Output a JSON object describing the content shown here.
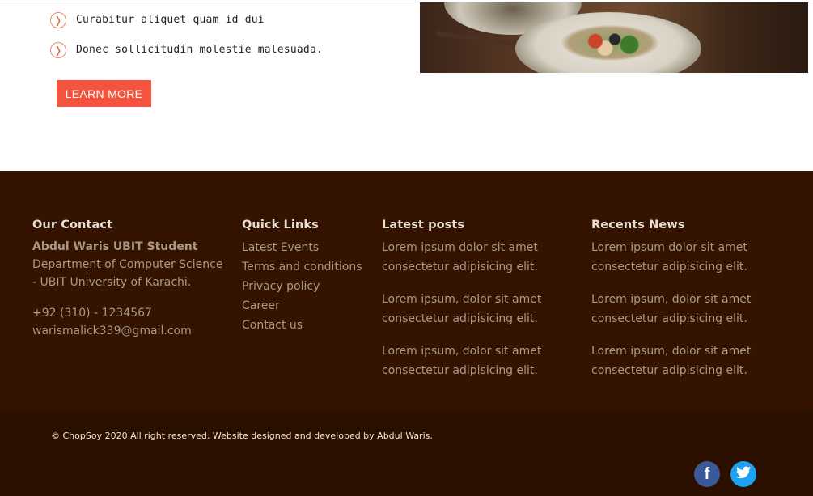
{
  "features": [
    {
      "bullet": "❭",
      "text": "Curabitur aliquet quam id dui"
    },
    {
      "bullet": "❭",
      "text": "Donec sollicitudin molestie malesuada."
    }
  ],
  "learn_more": "LEARN MORE",
  "footer": {
    "contact": {
      "heading": "Our Contact",
      "name": "Abdul Waris UBIT Student",
      "dept_line1": "Department of Computer Science",
      "dept_line2": "- UBIT University of Karachi.",
      "phone": "+92 (310) - 1234567",
      "email": "warismalick339@gmail.com"
    },
    "quick_links": {
      "heading": "Quick Links",
      "items": [
        "Latest Events",
        "Terms and conditions",
        "Privacy policy",
        "Career",
        "Contact us"
      ]
    },
    "latest_posts": {
      "heading": "Latest posts",
      "posts": [
        {
          "line1": "Lorem ipsum dolor sit amet",
          "line2": "consectetur adipisicing elit."
        },
        {
          "line1": "Lorem ipsum, dolor sit amet",
          "line2": "consectetur adipisicing elit."
        },
        {
          "line1": "Lorem ipsum, dolor sit amet",
          "line2": "consectetur adipisicing elit."
        }
      ]
    },
    "recent_news": {
      "heading": "Recents News",
      "posts": [
        {
          "line1": "Lorem ipsum dolor sit amet",
          "line2": "consectetur adipisicing elit."
        },
        {
          "line1": "Lorem ipsum, dolor sit amet",
          "line2": "consectetur adipisicing elit."
        },
        {
          "line1": "Lorem ipsum, dolor sit amet",
          "line2": "consectetur adipisicing elit."
        }
      ]
    },
    "copyright": "© ChopSoy 2020 All right reserved. Website designed and developed by Abdul Waris.",
    "social": [
      {
        "name": "facebook-icon",
        "glyph": "f",
        "color": "#3b5998"
      },
      {
        "name": "twitter-icon",
        "glyph": "🐦",
        "color": "#1da1f2"
      }
    ]
  },
  "colors": {
    "accent": "#f4533e",
    "footer_bg": "#341300",
    "footer_text": "#a9988a"
  }
}
